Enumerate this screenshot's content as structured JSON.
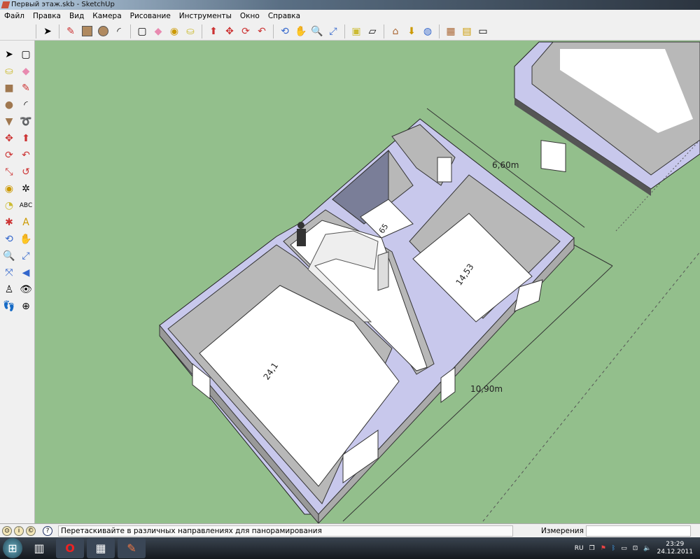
{
  "window": {
    "title": "Первый этаж.skb - SketchUp"
  },
  "menu": [
    "Файл",
    "Правка",
    "Вид",
    "Камера",
    "Рисование",
    "Инструменты",
    "Окно",
    "Справка"
  ],
  "toolbar": [
    "select",
    "pencil",
    "rectangle",
    "circle",
    "arc",
    "make-component",
    "eraser",
    "tape-measure",
    "paint-bucket",
    "push-pull",
    "move",
    "rotate",
    "follow-me",
    "orbit",
    "pan",
    "zoom",
    "zoom-extents",
    "section",
    "top-view",
    "front-view",
    "iso-view",
    "warehouse",
    "layers",
    "components",
    "materials"
  ],
  "left_toolbar": [
    "select",
    "make-component",
    "paint-bucket",
    "eraser",
    "rectangle",
    "pencil",
    "circle",
    "arc",
    "polygon",
    "freehand",
    "move",
    "push-pull",
    "rotate",
    "follow-me",
    "scale",
    "offset",
    "tape-measure",
    "dimension",
    "protractor",
    "text",
    "axes",
    "3d-text",
    "orbit",
    "pan",
    "zoom",
    "zoom-window",
    "zoom-extents",
    "previous",
    "position-camera",
    "look-around",
    "walk",
    "section-plane"
  ],
  "model": {
    "dimensions": [
      "6,60m",
      "10,90m"
    ],
    "room_areas": [
      "24,1",
      "14,53",
      "65"
    ]
  },
  "status": {
    "hint": "Перетаскивайте в различных направлениях для панорамирования",
    "measurements_label": "Измерения",
    "measurements_value": ""
  },
  "taskbar": {
    "lang": "RU",
    "time": "23:29",
    "date": "24.12.2011"
  },
  "colors": {
    "ground": "#93bf8c",
    "wall_top": "#c8c8ec",
    "wall": "#b8b8b8",
    "floor": "#ffffff"
  }
}
